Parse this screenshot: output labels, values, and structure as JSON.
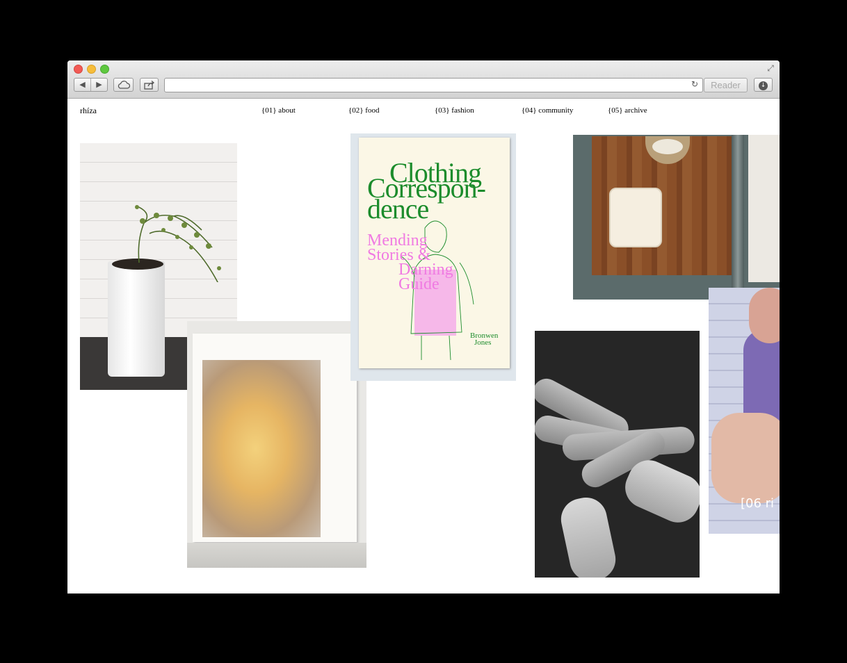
{
  "browser": {
    "back_icon": "◀",
    "forward_icon": "▶",
    "address_value": "",
    "reader_label": "Reader"
  },
  "site": {
    "title": "rhíza",
    "nav": [
      {
        "label": "{01} about"
      },
      {
        "label": "{02} food"
      },
      {
        "label": "{03} fashion"
      },
      {
        "label": "{04} community"
      },
      {
        "label": "{05} archive"
      }
    ]
  },
  "zine": {
    "title_line1": "Clothing",
    "title_line2": "Correspon-",
    "title_line3": "dence",
    "subtitle_line1": "Mending",
    "subtitle_line2": "Stories &",
    "subtitle_line3": "Darning",
    "subtitle_line4": "Guide",
    "author_line1": "Bronwen",
    "author_line2": "Jones"
  },
  "video_caption": "[06 ri",
  "colors": {
    "zine_green": "#1c8c2c",
    "zine_pink": "#f07ae2"
  }
}
